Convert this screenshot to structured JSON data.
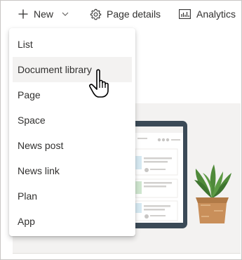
{
  "command_bar": {
    "new_label": "New",
    "new_icon": "plus-icon",
    "new_chevron_icon": "chevron-down-icon",
    "page_details_label": "Page details",
    "page_details_icon": "gear-icon",
    "analytics_label": "Analytics",
    "analytics_icon": "bar-chart-icon"
  },
  "new_menu": {
    "items": [
      {
        "label": "List"
      },
      {
        "label": "Document library",
        "hovered": true
      },
      {
        "label": "Page"
      },
      {
        "label": "Space"
      },
      {
        "label": "News post"
      },
      {
        "label": "News link"
      },
      {
        "label": "Plan"
      },
      {
        "label": "App"
      }
    ]
  },
  "colors": {
    "text": "#323130",
    "hover_bg": "#f3f2f1",
    "page_bg": "#f3f2f1",
    "tablet_frame": "#3b4a57",
    "plant_green": "#4f8a3a",
    "pot": "#c98f5a"
  },
  "cursor_icon": "hand-pointer-icon"
}
